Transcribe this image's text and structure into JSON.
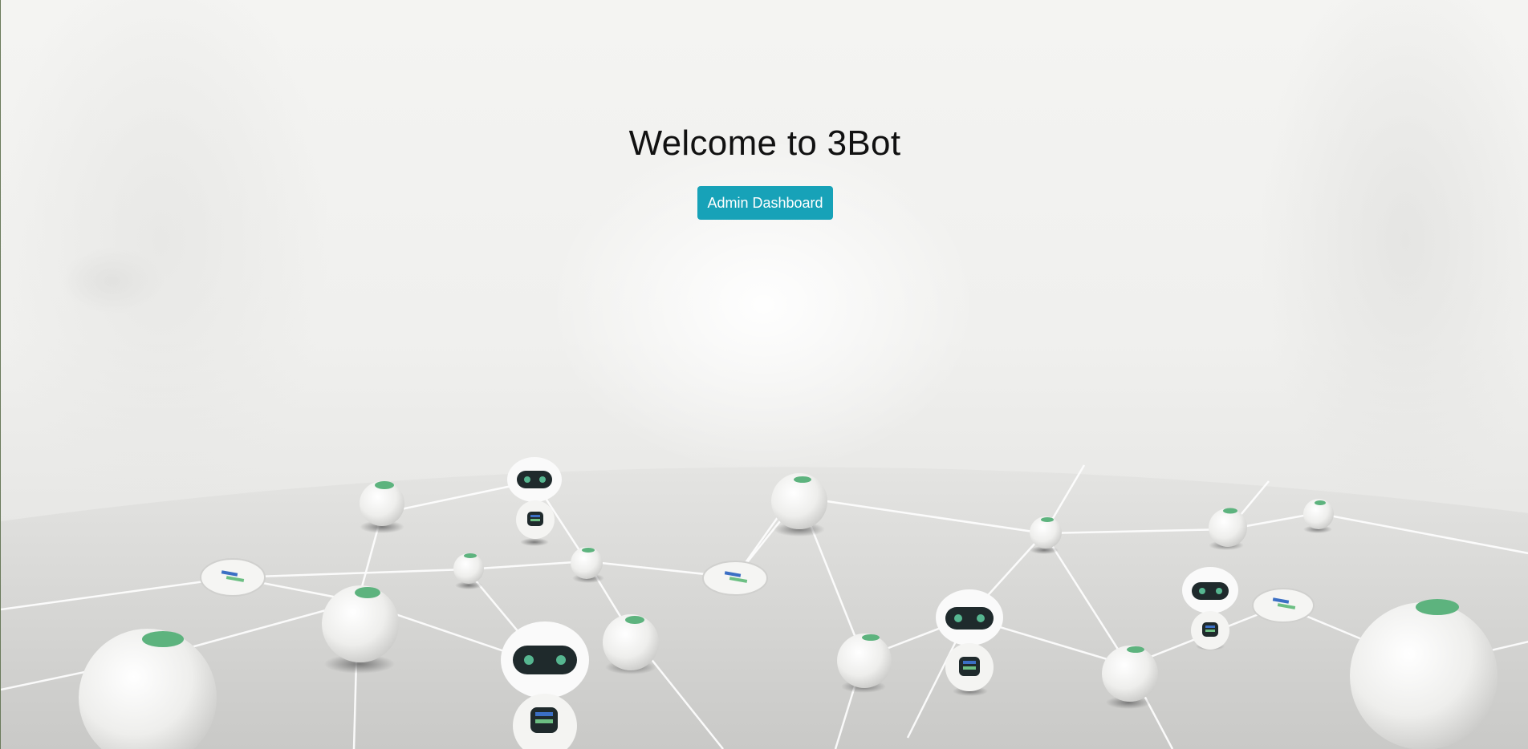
{
  "hero": {
    "title": "Welcome to 3Bot",
    "button_label": "Admin Dashboard"
  },
  "colors": {
    "button": "#17a2b8",
    "background": "#f0f0ee"
  }
}
